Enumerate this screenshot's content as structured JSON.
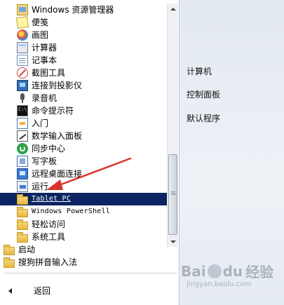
{
  "programs": [
    {
      "label": "Windows 资源管理器",
      "icon": "explorer-icon"
    },
    {
      "label": "便笺",
      "icon": "sticky-notes-icon"
    },
    {
      "label": "画图",
      "icon": "paint-icon"
    },
    {
      "label": "计算器",
      "icon": "calculator-icon"
    },
    {
      "label": "记事本",
      "icon": "notepad-icon"
    },
    {
      "label": "截图工具",
      "icon": "snipping-tool-icon"
    },
    {
      "label": "连接到投影仪",
      "icon": "projector-icon"
    },
    {
      "label": "录音机",
      "icon": "sound-recorder-icon"
    },
    {
      "label": "命令提示符",
      "icon": "command-prompt-icon"
    },
    {
      "label": "入门",
      "icon": "getting-started-icon"
    },
    {
      "label": "数学输入面板",
      "icon": "math-input-panel-icon"
    },
    {
      "label": "同步中心",
      "icon": "sync-center-icon"
    },
    {
      "label": "写字板",
      "icon": "wordpad-icon"
    },
    {
      "label": "远程桌面连接",
      "icon": "remote-desktop-icon"
    },
    {
      "label": "运行",
      "icon": "run-icon"
    },
    {
      "label": "Tablet PC",
      "icon": "folder-icon",
      "selected": true
    },
    {
      "label": "Windows PowerShell",
      "icon": "folder-icon"
    },
    {
      "label": "轻松访问",
      "icon": "folder-icon"
    },
    {
      "label": "系统工具",
      "icon": "folder-icon"
    },
    {
      "label": "启动",
      "icon": "folder-icon"
    },
    {
      "label": "搜狗拼音输入法",
      "icon": "folder-icon"
    }
  ],
  "back_label": "返回",
  "right_pane": {
    "items": [
      "计算机",
      "控制面板",
      "默认程序"
    ]
  },
  "watermark": {
    "brand_a": "Bai",
    "brand_b": "du",
    "brand_cn": "经验",
    "url": "jingyan.baidu.com"
  },
  "colors": {
    "selection": "#0c2461",
    "annotation_arrow": "#d9342b"
  }
}
